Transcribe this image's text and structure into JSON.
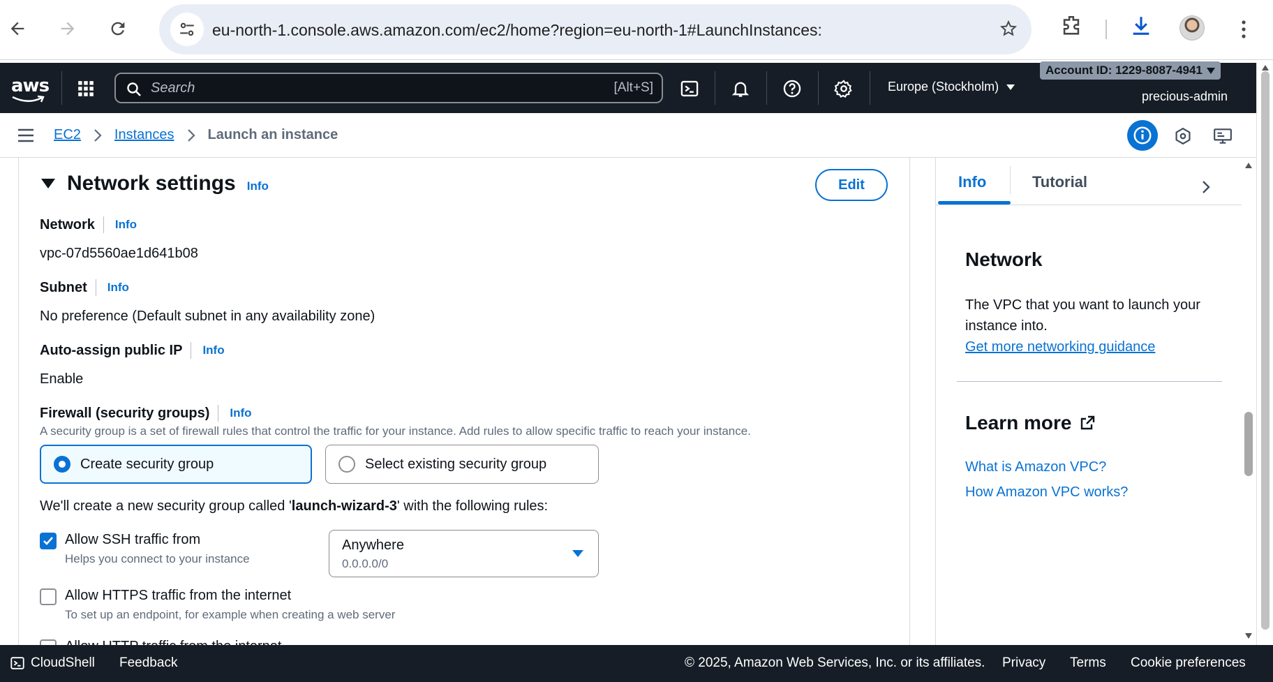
{
  "browser": {
    "url": "eu-north-1.console.aws.amazon.com/ec2/home?region=eu-north-1#LaunchInstances:",
    "icons": [
      "back-icon",
      "forward-icon",
      "reload-icon",
      "site-settings-icon",
      "bookmark-star-icon",
      "extensions-icon",
      "download-icon",
      "profile-avatar",
      "more-menu-icon"
    ]
  },
  "aws_nav": {
    "logo": "aws",
    "search_placeholder": "Search",
    "search_shortcut": "[Alt+S]",
    "region": "Europe (Stockholm)",
    "account": "Account ID: 1229-8087-4941",
    "user": "precious-admin"
  },
  "breadcrumb": {
    "items": [
      "EC2",
      "Instances"
    ],
    "current": "Launch an instance"
  },
  "network_settings": {
    "title": "Network settings",
    "info": "Info",
    "edit": "Edit",
    "network_label": "Network",
    "network_value": "vpc-07d5560ae1d641b08",
    "subnet_label": "Subnet",
    "subnet_value": "No preference (Default subnet in any availability zone)",
    "public_ip_label": "Auto-assign public IP",
    "public_ip_value": "Enable",
    "firewall_label": "Firewall (security groups)",
    "firewall_desc": "A security group is a set of firewall rules that control the traffic for your instance. Add rules to allow specific traffic to reach your instance.",
    "option_create": "Create security group",
    "option_select": "Select existing security group",
    "sg_note_pre": "We'll create a new security group called '",
    "sg_name": "launch-wizard-3",
    "sg_note_post": "' with the following rules:",
    "rules": [
      {
        "label": "Allow SSH traffic from",
        "desc": "Helps you connect to your instance",
        "checked": true
      },
      {
        "label": "Allow HTTPS traffic from the internet",
        "desc": "To set up an endpoint, for example when creating a web server",
        "checked": false
      },
      {
        "label": "Allow HTTP traffic from the internet",
        "checked": false
      }
    ],
    "ssh_source": "Anywhere",
    "ssh_cidr": "0.0.0.0/0"
  },
  "help_panel": {
    "tabs": [
      "Info",
      "Tutorial"
    ],
    "heading": "Network",
    "text": "The VPC that you want to launch your instance into.",
    "guidance_link": "Get more networking guidance",
    "learn_more": "Learn more",
    "links": [
      "What is Amazon VPC?",
      "How Amazon VPC works?"
    ]
  },
  "footer": {
    "cloudshell": "CloudShell",
    "feedback": "Feedback",
    "copyright": "© 2025, Amazon Web Services, Inc. or its affiliates.",
    "links": [
      "Privacy",
      "Terms",
      "Cookie preferences"
    ]
  },
  "colors": {
    "accent": "#0972d3",
    "nav_bg": "#161d26"
  }
}
